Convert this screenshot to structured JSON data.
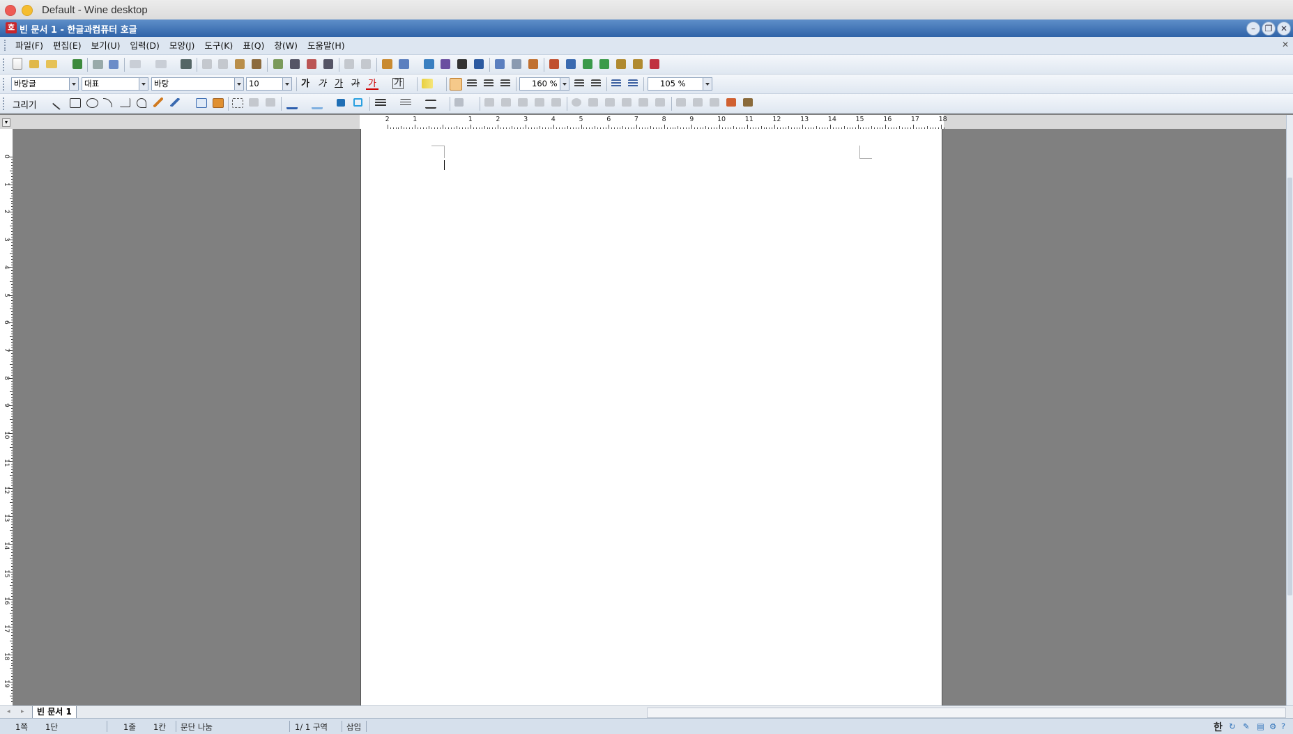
{
  "os": {
    "window_title": "Default - Wine desktop"
  },
  "app": {
    "title": "빈 문서 1 - 한글과컴퓨터 호글"
  },
  "menu": [
    "파일(F)",
    "편집(E)",
    "보기(U)",
    "입력(D)",
    "모양(J)",
    "도구(K)",
    "표(Q)",
    "창(W)",
    "도움말(H)"
  ],
  "format_toolbar": {
    "style": "바탕글",
    "language": "대표",
    "font": "바탕",
    "size": "10",
    "line_spacing": "160 %",
    "zoom": "105 %",
    "bold": "가",
    "italic": "가",
    "underline": "가",
    "strike": "가",
    "color": "가",
    "outline": "가"
  },
  "draw_toolbar": {
    "label": "그리기"
  },
  "ruler": {
    "h_numbers": [
      "2",
      "1",
      "",
      "1",
      "2",
      "3",
      "4",
      "5",
      "6",
      "7",
      "8",
      "9",
      "10",
      "11",
      "12",
      "13",
      "14",
      "15",
      "16",
      "17",
      "18"
    ],
    "v_numbers": [
      "0",
      "1",
      "2",
      "3",
      "4",
      "5",
      "6",
      "7",
      "8",
      "9",
      "10",
      "11",
      "12",
      "13",
      "14",
      "15",
      "16",
      "17",
      "18",
      "19"
    ]
  },
  "tabs": {
    "doc_tab": "빈 문서 1"
  },
  "status": {
    "page": "1쪽",
    "col": "1단",
    "line": "1줄",
    "column": "1칸",
    "para": "문단 나눔",
    "section": "1/  1 구역",
    "mode": "삽입"
  },
  "ime": {
    "lang": "한"
  },
  "colors": {
    "title_bar": "#2f63a8",
    "menu_bg": "#dde6f1",
    "workspace": "#808080"
  }
}
